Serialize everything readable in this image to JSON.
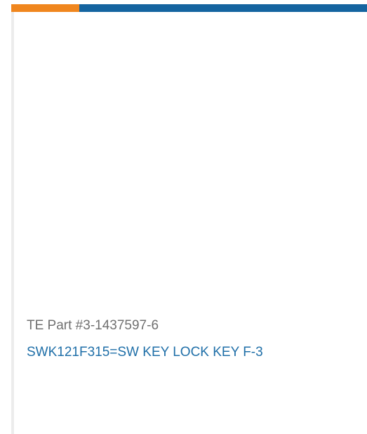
{
  "colors": {
    "accent_orange": "#f0861e",
    "accent_blue": "#1464a0",
    "text_gray": "#707070",
    "link_blue": "#1f6fa8"
  },
  "product": {
    "part_number": "TE Part #3-1437597-6",
    "name": "SWK121F315=SW KEY LOCK KEY F-3"
  }
}
